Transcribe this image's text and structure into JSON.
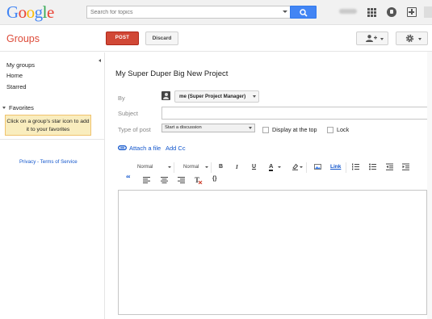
{
  "header": {
    "logo_letters": [
      {
        "ch": "G",
        "color": "#4285f4"
      },
      {
        "ch": "o",
        "color": "#ea4335"
      },
      {
        "ch": "o",
        "color": "#fbbc05"
      },
      {
        "ch": "g",
        "color": "#4285f4"
      },
      {
        "ch": "l",
        "color": "#34a853"
      },
      {
        "ch": "e",
        "color": "#ea4335"
      }
    ],
    "search_placeholder": "Search for topics",
    "icons": [
      "search-icon",
      "apps-icon",
      "notifications-icon",
      "share-icon"
    ]
  },
  "subbar": {
    "title": "Groups",
    "post_label": "POST",
    "discard_label": "Discard",
    "accent": "#dd4b39"
  },
  "sidebar": {
    "items": [
      "My groups",
      "Home",
      "Starred"
    ],
    "favorites_label": "Favorites",
    "favorites_hint": "Click on a group's star icon to add it to your favorites",
    "footer": "Privacy - Terms of Service"
  },
  "compose": {
    "title": "My Super Duper Big New Project",
    "by_label": "By",
    "by_value": "me (Super Project Manager)",
    "subject_label": "Subject",
    "subject_value": "",
    "type_label": "Type of post",
    "type_value": "Start a discussion",
    "display_top_label": "Display at the top",
    "lock_label": "Lock",
    "attach_label": "Attach a file",
    "addcc_label": "Add Cc"
  },
  "toolbar": {
    "font_label": "Normal",
    "size_label": "Normal",
    "bold": "B",
    "italic": "I",
    "underline": "U",
    "text_color": "A",
    "link": "Link",
    "quote": "“",
    "code": "{}"
  }
}
